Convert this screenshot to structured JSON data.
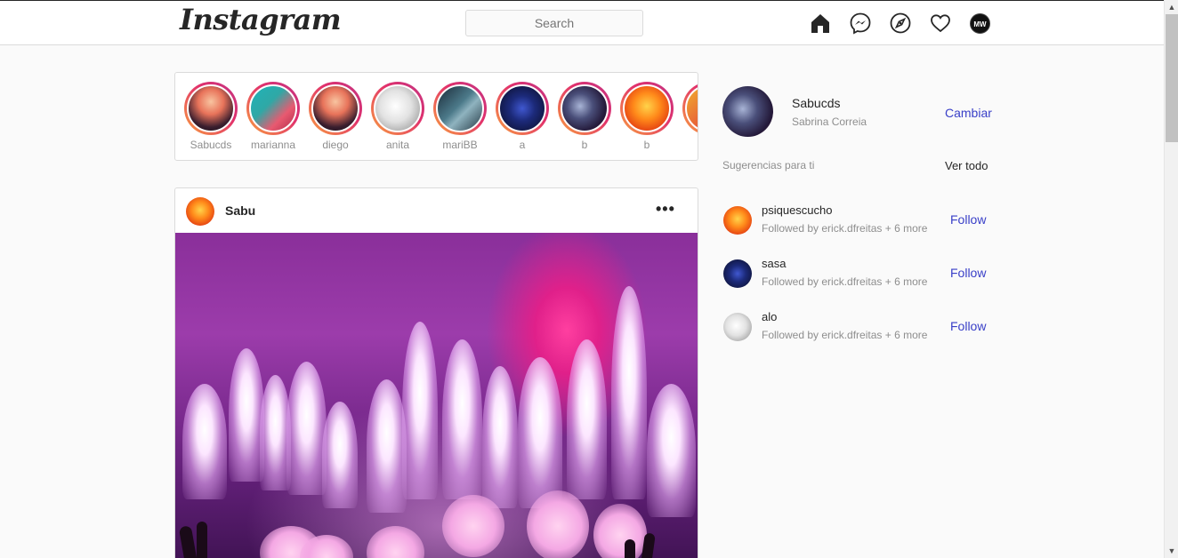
{
  "header": {
    "logo": "Instagram",
    "search_placeholder": "Search",
    "avatar_text": "MW",
    "icons": [
      "home-icon",
      "messenger-icon",
      "explore-compass-icon",
      "heart-icon"
    ]
  },
  "stories": [
    {
      "name": "Sabucds",
      "image": "concert-crowd"
    },
    {
      "name": "marianna",
      "image": "teal-abstract"
    },
    {
      "name": "diego",
      "image": "concert-crowd"
    },
    {
      "name": "anita",
      "image": "white-abstract"
    },
    {
      "name": "mariBB",
      "image": "guitar"
    },
    {
      "name": "a",
      "image": "dj-blue"
    },
    {
      "name": "b",
      "image": "microphone"
    },
    {
      "name": "b",
      "image": "orange-flowers"
    }
  ],
  "post": {
    "username": "Sabu",
    "more_label": "•••"
  },
  "profile": {
    "username": "Sabucds",
    "full_name": "Sabrina Correia",
    "switch_label": "Cambiar"
  },
  "suggestions": {
    "title": "Sugerencias para ti",
    "see_all": "Ver todo",
    "items": [
      {
        "username": "psiquescucho",
        "subtitle": "Followed by erick.dfreitas + 6 more",
        "follow_label": "Follow"
      },
      {
        "username": "sasa",
        "subtitle": "Followed by erick.dfreitas + 6 more",
        "follow_label": "Follow"
      },
      {
        "username": "alo",
        "subtitle": "Followed by erick.dfreitas + 6 more",
        "follow_label": "Follow"
      }
    ]
  },
  "colors": {
    "accent_link": "#3a40c8",
    "story_ring_start": "#f9a03f",
    "story_ring_end": "#c13584",
    "background": "#fafafa"
  }
}
